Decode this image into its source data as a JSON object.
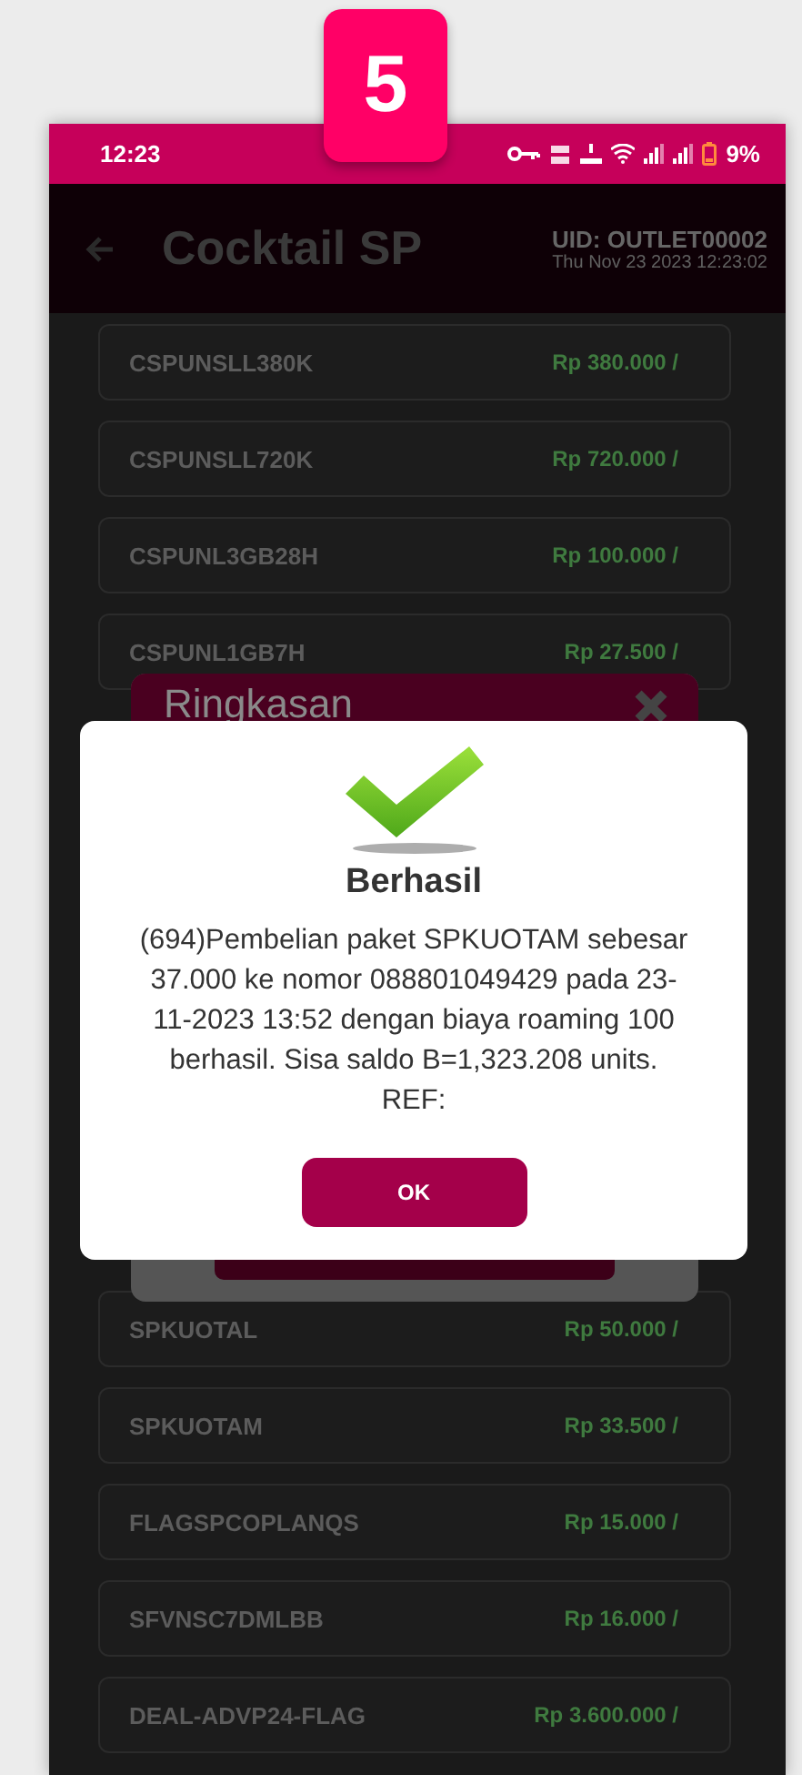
{
  "step_badge": "5",
  "status_bar": {
    "time": "12:23",
    "battery": "9%"
  },
  "app_bar": {
    "title": "Cocktail SP",
    "uid": "UID: OUTLET00002",
    "datetime": "Thu Nov 23 2023 12:23:02"
  },
  "products_top": [
    {
      "code": "CSPUNSLL380K",
      "price": "Rp 380.000 /"
    },
    {
      "code": "CSPUNSLL720K",
      "price": "Rp 720.000 /"
    },
    {
      "code": "CSPUNL3GB28H",
      "price": "Rp 100.000 /"
    },
    {
      "code": "CSPUNL1GB7H",
      "price": "Rp 27.500 /"
    }
  ],
  "products_bottom": [
    {
      "code": "SPKUOTAL",
      "price": "Rp 50.000 /"
    },
    {
      "code": "SPKUOTAM",
      "price": "Rp 33.500 /"
    },
    {
      "code": "FLAGSPCOPLANQS",
      "price": "Rp 15.000 /"
    },
    {
      "code": "SFVNSC7DMLBB",
      "price": "Rp 16.000 /"
    },
    {
      "code": "DEAL-ADVP24-FLAG",
      "price": "Rp 3.600.000 /"
    }
  ],
  "summary_dialog": {
    "title": "Ringkasan"
  },
  "success_dialog": {
    "title": "Berhasil",
    "message": "(694)Pembelian paket SPKUOTAM sebesar 37.000 ke nomor 088801049429 pada 23-11-2023 13:52 dengan biaya roaming 100 berhasil. Sisa saldo B=1,323.208 units. REF:",
    "ok_button": "OK"
  }
}
